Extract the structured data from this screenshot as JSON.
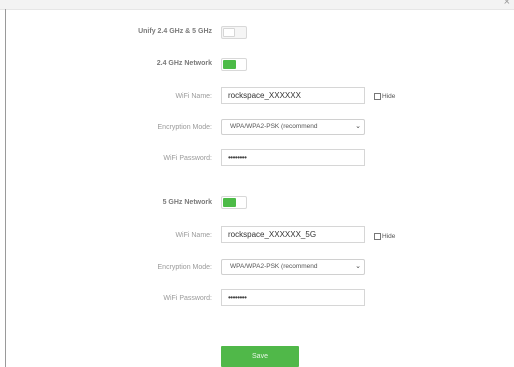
{
  "window": {
    "close_glyph": "×"
  },
  "unify": {
    "label": "Unify 2.4 GHz & 5 GHz",
    "enabled": false
  },
  "band24": {
    "label": "2.4 GHz Network",
    "enabled": true,
    "wifi_name_label": "WiFi Name:",
    "wifi_name_value": "rockspace_XXXXXX",
    "hide_label": "Hide",
    "encryption_label": "Encryption Mode:",
    "encryption_value": "WPA/WPA2-PSK (recommend",
    "password_label": "WiFi Password:",
    "password_value": "••••••••"
  },
  "band5": {
    "label": "5 GHz Network",
    "enabled": true,
    "wifi_name_label": "WiFi Name:",
    "wifi_name_value": "rockspace_XXXXXX_5G",
    "hide_label": "Hide",
    "encryption_label": "Encryption Mode:",
    "encryption_value": "WPA/WPA2-PSK (recommend",
    "password_label": "WiFi Password:",
    "password_value": "••••••••"
  },
  "actions": {
    "save_label": "Save"
  },
  "colors": {
    "accent": "#4cbb47"
  }
}
